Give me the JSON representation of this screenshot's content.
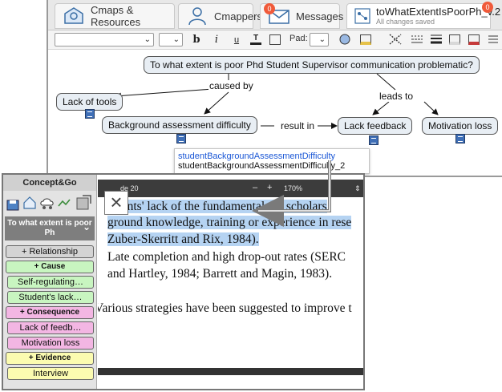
{
  "tabs": [
    {
      "label": "Cmaps & Resources"
    },
    {
      "label": "Cmappers"
    },
    {
      "label": "Messages",
      "badge": "0"
    },
    {
      "label": "toWhatExtentIsPoorPh_v.2",
      "sub": "All changes saved",
      "badge": "0"
    }
  ],
  "toolbar": {
    "pad_label": "Pad:",
    "bold": "b",
    "italic": "i",
    "underline": "u",
    "t_label": "T"
  },
  "map": {
    "root": "To what extent is poor Phd Student Supervisor communication problematic?",
    "links": {
      "caused_by": "caused by",
      "leads_to": "leads to",
      "result_in": "result in"
    },
    "concepts": {
      "lack_tools": "Lack of tools",
      "background": "Background assessment difficulty",
      "lack_feedback": "Lack feedback",
      "motivation": "Motivation loss"
    },
    "resources": [
      "studentBackgroundAssessmentDifficulty",
      "studentBackgroundAssessmentDifficulty_2"
    ]
  },
  "panel": {
    "header": "Concept&Go",
    "title": "To what extent is poor Ph",
    "relationship": "+ Relationship",
    "cause": "+ Cause",
    "cause_items": [
      "Self-regulating…",
      "Student's lack…"
    ],
    "consequence": "+ Consequence",
    "consequence_items": [
      "Lack of feedb…",
      "Motivation loss"
    ],
    "evidence": "+ Evidence",
    "evidence_items": [
      "Interview"
    ]
  },
  "pdf": {
    "page_label": "de 20",
    "minus": "–",
    "plus": "+",
    "zoom": "170%",
    "lines": [
      "dents' lack of the fundamentals of scholars",
      "ground knowledge, training or experience in rese",
      "Zuber-Skerritt and Rix, 1984).",
      "Late completion and high drop-out rates (SERC",
      "and Hartley, 1984; Barrett and Magin, 1983).",
      "Various strategies have been suggested to improve t"
    ],
    "close": "×"
  },
  "colors": {
    "accent_blue": "#3f6fb7",
    "badge": "#f05a3a",
    "arrow": "#7a7a7a"
  }
}
